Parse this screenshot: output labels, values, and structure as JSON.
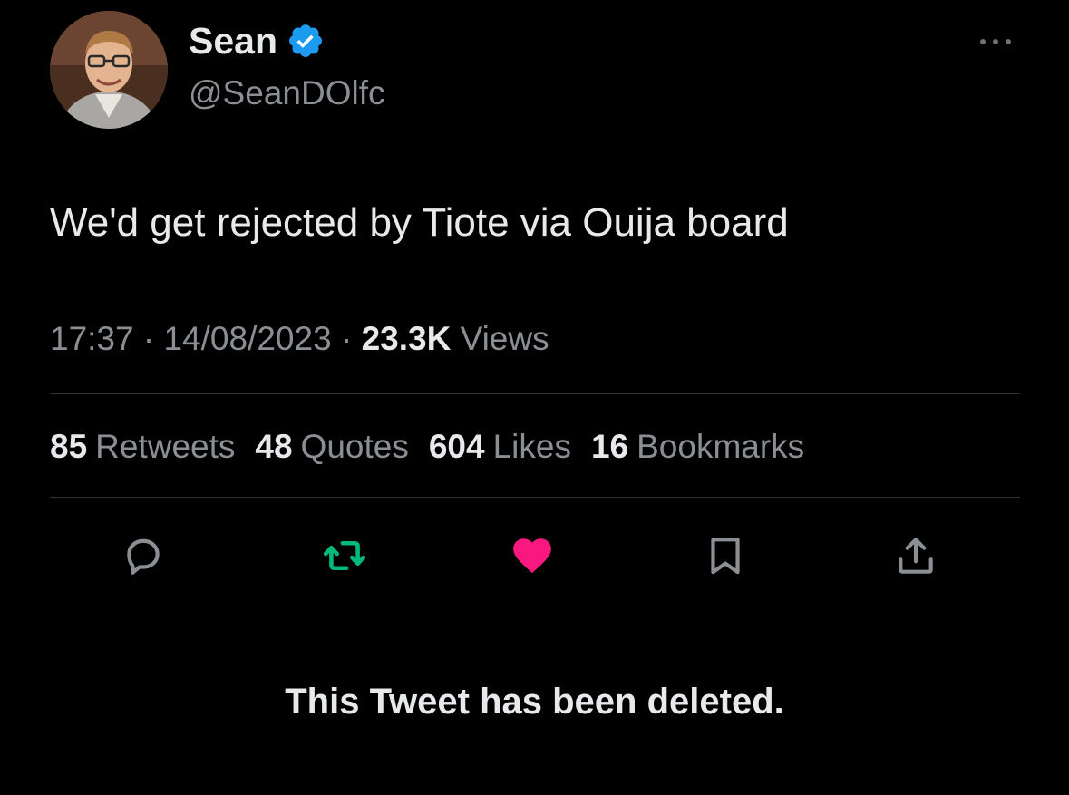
{
  "tweet": {
    "author": {
      "display_name": "Sean",
      "handle": "@SeanDOlfc",
      "verified": true,
      "verified_color": "#1d9bf0"
    },
    "text": "We'd get rejected by Tiote via Ouija board",
    "time": "17:37",
    "separator": "·",
    "date": "14/08/2023",
    "views_count": "23.3K",
    "views_label": "Views",
    "stats": [
      {
        "count": "85",
        "label": "Retweets"
      },
      {
        "count": "48",
        "label": "Quotes"
      },
      {
        "count": "604",
        "label": "Likes"
      },
      {
        "count": "16",
        "label": "Bookmarks"
      }
    ],
    "actions": [
      "reply-icon",
      "retweet-icon",
      "like-icon",
      "bookmark-icon",
      "share-icon"
    ],
    "state": {
      "retweeted": true,
      "liked": true
    },
    "colors": {
      "retweet_active": "#00ba7c",
      "like_active": "#f91880",
      "muted_text": "#8b8f94",
      "primary_text": "#e7e9ea",
      "background": "#000000"
    }
  },
  "notice": "This Tweet has been deleted."
}
